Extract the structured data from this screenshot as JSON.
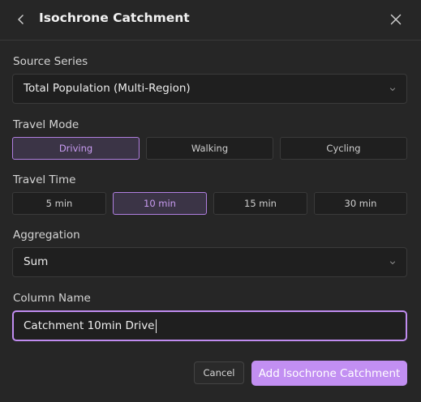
{
  "header": {
    "title": "Isochrone Catchment",
    "back_icon": "chevron-left-icon",
    "close_icon": "close-icon"
  },
  "source_series": {
    "label": "Source Series",
    "value": "Total Population (Multi-Region)"
  },
  "travel_mode": {
    "label": "Travel Mode",
    "options": [
      "Driving",
      "Walking",
      "Cycling"
    ],
    "selected": "Driving"
  },
  "travel_time": {
    "label": "Travel Time",
    "options": [
      "5 min",
      "10 min",
      "15 min",
      "30 min"
    ],
    "selected": "10 min"
  },
  "aggregation": {
    "label": "Aggregation",
    "value": "Sum"
  },
  "column_name": {
    "label": "Column Name",
    "value": "Catchment 10min Drive"
  },
  "footer": {
    "cancel_label": "Cancel",
    "submit_label": "Add Isochrone Catchment"
  },
  "colors": {
    "accent": "#c28ff2",
    "background": "#262626",
    "field": "#1f1f1f"
  }
}
